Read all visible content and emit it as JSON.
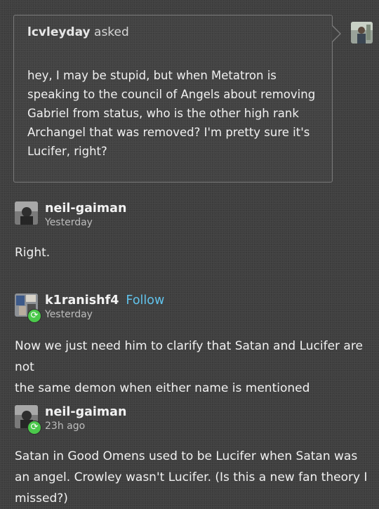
{
  "ask": {
    "asker": "lcvleyday",
    "verb": "asked",
    "lines": [
      "hey, I may be stupid, but when Metatron is",
      "speaking to the council of Angels about removing",
      "Gabriel from status, who is the other high rank",
      "Archangel that was removed? I'm pretty sure it's",
      "Lucifer, right?"
    ]
  },
  "posts": [
    {
      "username": "neil-gaiman",
      "timestamp": "Yesterday",
      "lines": [
        "Right."
      ]
    },
    {
      "username": "k1ranishf4",
      "follow_label": "Follow",
      "timestamp": "Yesterday",
      "lines": [
        "Now we just need him to clarify that Satan and Lucifer are not",
        "the same demon when either name is mentioned"
      ]
    },
    {
      "username": "neil-gaiman",
      "timestamp": "23h ago",
      "lines": [
        "Satan in Good Omens used to be Lucifer when Satan was",
        "an angel. Crowley wasn't Lucifer. (Is this a new fan theory I",
        "missed?)"
      ]
    }
  ],
  "colors": {
    "follow": "#61c3ec",
    "reblog_badge": "#4bc94b",
    "background": "#3f3f3f"
  },
  "icons": {
    "reblog": "reblog-icon"
  }
}
